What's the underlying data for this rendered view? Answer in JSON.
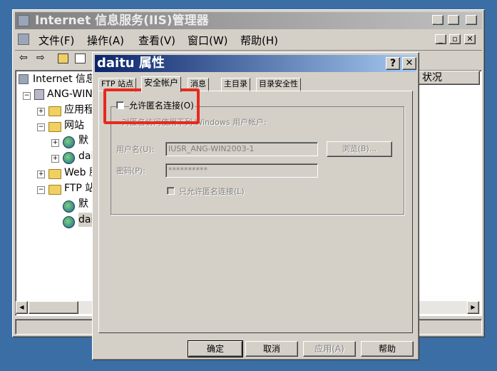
{
  "main_window": {
    "title": "Internet 信息服务(IIS)管理器",
    "menu": [
      {
        "label": "文件(F)"
      },
      {
        "label": "操作(A)"
      },
      {
        "label": "查看(V)"
      },
      {
        "label": "窗口(W)"
      },
      {
        "label": "帮助(H)"
      }
    ],
    "tree": {
      "root": "Internet 信息",
      "server": "ANG-WIN",
      "items": [
        "应用程",
        "网站",
        "默",
        "dai",
        "Web 服",
        "FTP 站",
        "默",
        "dai"
      ]
    },
    "right_header": "状况"
  },
  "dialog": {
    "title": "daitu 属性",
    "tabs": [
      "FTP 站点",
      "安全帐户",
      "消息",
      "主目录",
      "目录安全性"
    ],
    "active_tab": "安全帐户",
    "allow_anonymous_label": "允许匿名连接(O)",
    "allow_anonymous_checked": false,
    "group_caption": "对匿名访问使用下列 Windows 用户帐户:",
    "username_label": "用户名(U):",
    "username_value": "IUSR_ANG-WIN2003-1",
    "browse_label": "浏览(B)...",
    "password_label": "密码(P):",
    "password_value": "**********",
    "anon_only_label": "只允许匿名连接(L)",
    "buttons": {
      "ok": "确定",
      "cancel": "取消",
      "apply": "应用(A)",
      "help": "帮助"
    }
  },
  "highlight_color": "#e8291c"
}
